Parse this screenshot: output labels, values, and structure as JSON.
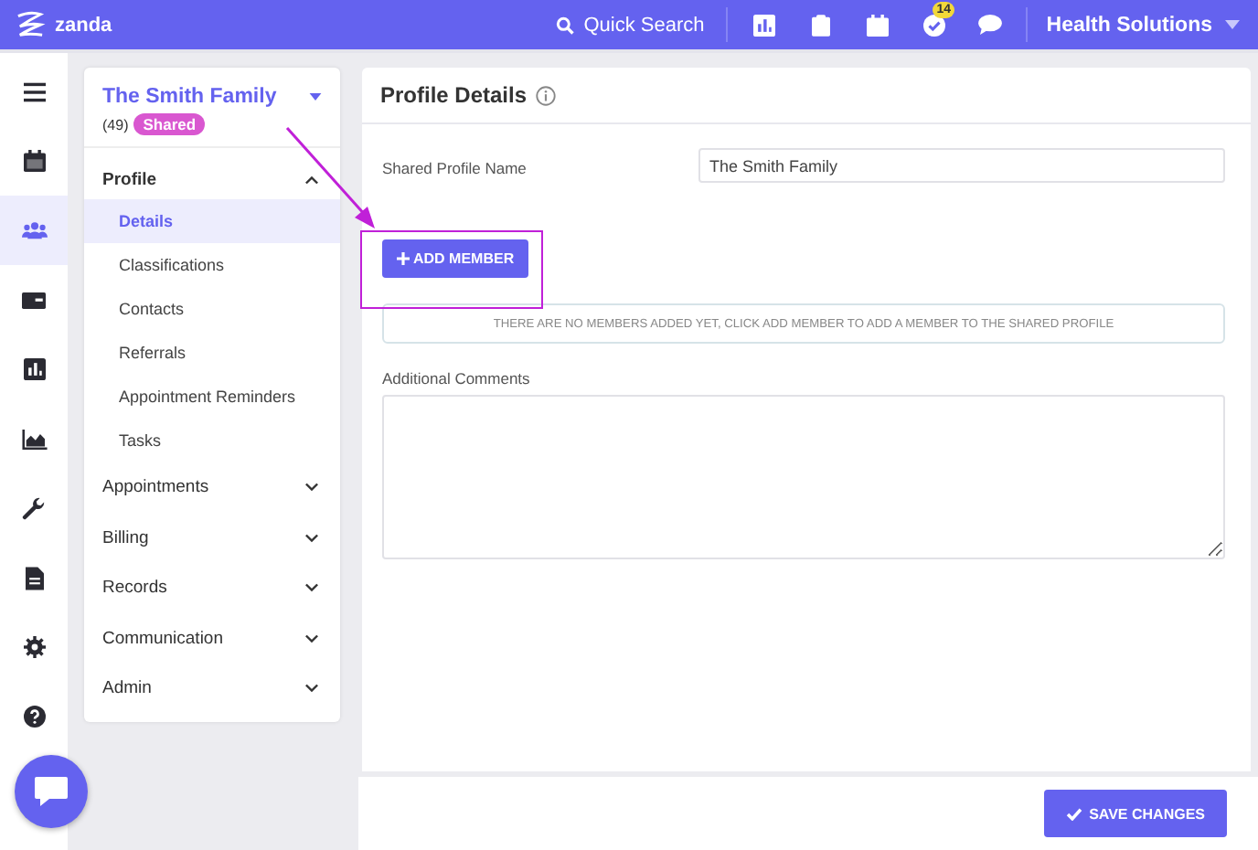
{
  "topbar": {
    "brand": "zanda",
    "search": "Quick Search",
    "icons": [
      {
        "kind": "chart"
      },
      {
        "kind": "clipboard"
      },
      {
        "kind": "calendar"
      },
      {
        "kind": "check",
        "badge": "14"
      },
      {
        "kind": "chat"
      }
    ],
    "account": "Health Solutions"
  },
  "rail": [
    {
      "kind": "menu",
      "selected": false
    },
    {
      "kind": "calendar",
      "selected": false
    },
    {
      "kind": "people",
      "selected": true
    },
    {
      "kind": "card",
      "selected": false
    },
    {
      "kind": "chart",
      "selected": false
    },
    {
      "kind": "area",
      "selected": false
    },
    {
      "kind": "wrench",
      "selected": false
    },
    {
      "kind": "document",
      "selected": false
    },
    {
      "kind": "gear",
      "selected": false
    },
    {
      "kind": "help",
      "selected": false
    }
  ],
  "profile": {
    "name": "The Smith Family",
    "count": "(49)",
    "tag": "Shared"
  },
  "nav": [
    {
      "label": "Profile",
      "expanded": true,
      "children": [
        {
          "label": "Details",
          "selected": true
        },
        {
          "label": "Classifications",
          "selected": false
        },
        {
          "label": "Contacts",
          "selected": false
        },
        {
          "label": "Referrals",
          "selected": false
        },
        {
          "label": "Appointment Reminders",
          "selected": false
        },
        {
          "label": "Tasks",
          "selected": false
        }
      ]
    },
    {
      "label": "Appointments",
      "expanded": false
    },
    {
      "label": "Billing",
      "expanded": false
    },
    {
      "label": "Records",
      "expanded": false
    },
    {
      "label": "Communication",
      "expanded": false
    },
    {
      "label": "Admin",
      "expanded": false
    }
  ],
  "main": {
    "title": "Profile Details",
    "name_label": "Shared Profile Name",
    "name_value": "The Smith Family",
    "add_button": "ADD MEMBER",
    "empty_notice": "THERE ARE NO MEMBERS ADDED YET, CLICK ADD MEMBER TO ADD A MEMBER TO THE SHARED PROFILE",
    "comments_label": "Additional Comments",
    "save_button": "SAVE CHANGES"
  }
}
